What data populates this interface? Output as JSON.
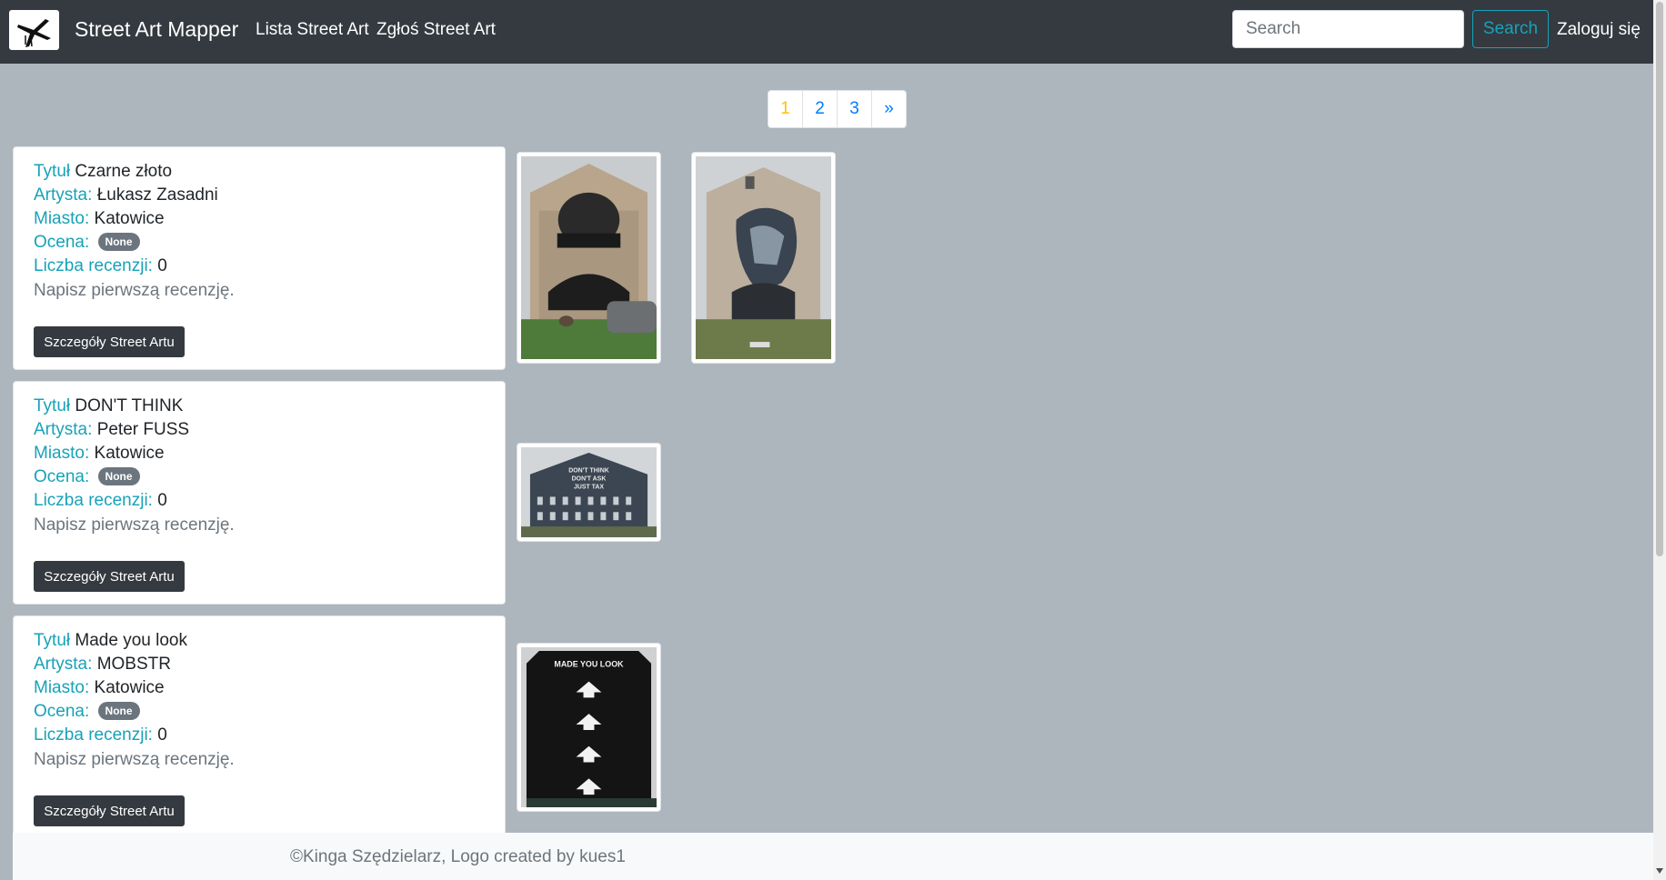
{
  "navbar": {
    "brand": "Street Art Mapper",
    "links": [
      "Lista Street Art",
      "Zgłoś Street Art"
    ],
    "search_placeholder": "Search",
    "search_button": "Search",
    "login": "Zaloguj się"
  },
  "pagination": {
    "pages": [
      "1",
      "2",
      "3"
    ],
    "next": "»",
    "active": "1"
  },
  "labels": {
    "title": "Tytuł",
    "artist": "Artysta:",
    "city": "Miasto:",
    "rating": "Ocena:",
    "reviews": "Liczba recenzji:",
    "write_review": "Napisz pierwszą recenzję.",
    "details_button": "Szczegóły Street Artu"
  },
  "artworks": [
    {
      "title": "Czarne złoto",
      "artist": "Łukasz Zasadni",
      "city": "Katowice",
      "rating": "None",
      "reviews": "0"
    },
    {
      "title": "DON'T THINK",
      "artist": "Peter FUSS",
      "city": "Katowice",
      "rating": "None",
      "reviews": "0"
    },
    {
      "title": "Made you look",
      "artist": "MOBSTR",
      "city": "Katowice",
      "rating": "None",
      "reviews": "0"
    }
  ],
  "mural_texts": {
    "dont_think": [
      "DON'T THINK",
      "DON'T ASK",
      "JUST TAX"
    ],
    "made_you_look": "MADE YOU LOOK"
  },
  "footer": {
    "text": "©Kinga Szędzielarz, Logo created by kues1"
  },
  "colors": {
    "navbar": "#343a40",
    "page_bg": "#adb5bd",
    "label": "#17a2b8",
    "link": "#007bff",
    "active_page": "#ffc107"
  }
}
